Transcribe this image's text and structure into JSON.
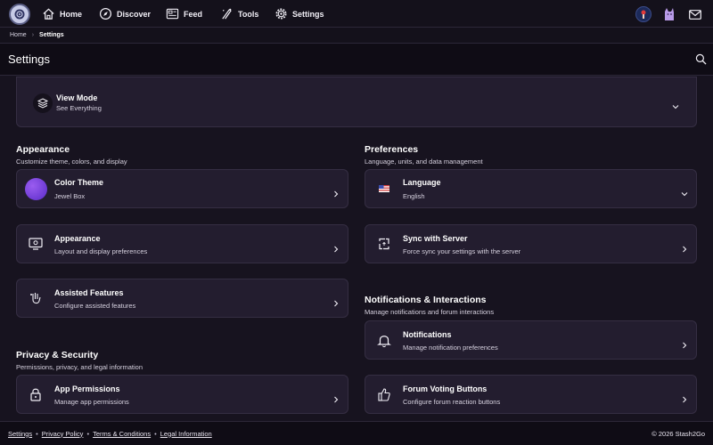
{
  "nav": {
    "items": [
      {
        "label": "Home",
        "icon": "home-icon"
      },
      {
        "label": "Discover",
        "icon": "compass-icon"
      },
      {
        "label": "Feed",
        "icon": "feed-icon"
      },
      {
        "label": "Tools",
        "icon": "tools-icon"
      },
      {
        "label": "Settings",
        "icon": "gear-icon"
      }
    ]
  },
  "breadcrumb": {
    "home": "Home",
    "current": "Settings"
  },
  "header": {
    "title": "Settings"
  },
  "view_mode": {
    "title": "View Mode",
    "subtitle": "See Everything"
  },
  "appearance_section": {
    "title": "Appearance",
    "subtitle": "Customize theme, colors, and display"
  },
  "preferences_section": {
    "title": "Preferences",
    "subtitle": "Language, units, and data management"
  },
  "privacy_section": {
    "title": "Privacy & Security",
    "subtitle": "Permissions, privacy, and legal information"
  },
  "notifications_section": {
    "title": "Notifications & Interactions",
    "subtitle": "Manage notifications and forum interactions"
  },
  "cards": {
    "color_theme": {
      "title": "Color Theme",
      "subtitle": "Jewel Box"
    },
    "appearance": {
      "title": "Appearance",
      "subtitle": "Layout and display preferences"
    },
    "assisted": {
      "title": "Assisted Features",
      "subtitle": "Configure assisted features"
    },
    "permissions": {
      "title": "App Permissions",
      "subtitle": "Manage app permissions"
    },
    "language": {
      "title": "Language",
      "subtitle": "English"
    },
    "sync": {
      "title": "Sync with Server",
      "subtitle": "Force sync your settings with the server"
    },
    "notifications": {
      "title": "Notifications",
      "subtitle": "Manage notification preferences"
    },
    "voting": {
      "title": "Forum Voting Buttons",
      "subtitle": "Configure forum reaction buttons"
    }
  },
  "footer": {
    "links": [
      "Settings",
      "Privacy Policy",
      "Terms & Conditions",
      "Legal Information"
    ],
    "copyright": "© 2026 Stash2Go"
  },
  "colors": {
    "accent": "#7b4de0",
    "background": "#17131f",
    "card": "#231d2f"
  }
}
